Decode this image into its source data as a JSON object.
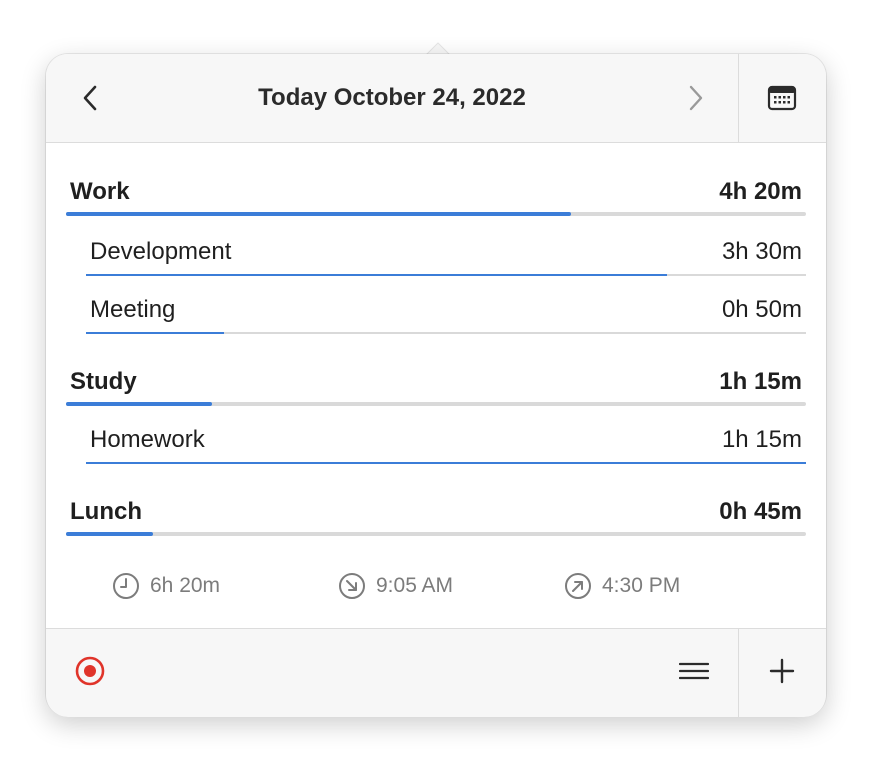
{
  "header": {
    "title": "Today October 24, 2022"
  },
  "entries": [
    {
      "label": "Work",
      "value": "4h 20m",
      "level": "top",
      "progress": 0.683
    },
    {
      "label": "Development",
      "value": "3h 30m",
      "level": "sub",
      "progress": 0.807
    },
    {
      "label": "Meeting",
      "value": "0h 50m",
      "level": "sub",
      "progress": 0.192
    },
    {
      "label": "Study",
      "value": "1h 15m",
      "level": "top",
      "progress": 0.197
    },
    {
      "label": "Homework",
      "value": "1h 15m",
      "level": "sub",
      "progress": 1.0
    },
    {
      "label": "Lunch",
      "value": "0h 45m",
      "level": "top",
      "progress": 0.118
    }
  ],
  "stats": {
    "total": "6h 20m",
    "start": "9:05 AM",
    "end": "4:30 PM"
  },
  "colors": {
    "accent": "#3b7dd8",
    "record": "#e0342a",
    "track": "#d9d9d9"
  },
  "icons": {
    "prev": "chevron-left-icon",
    "next": "chevron-right-icon",
    "calendar": "calendar-icon",
    "total": "clock-icon",
    "start": "arrow-down-right-circle-icon",
    "end": "arrow-up-right-circle-icon",
    "record": "record-icon",
    "menu": "menu-icon",
    "add": "plus-icon"
  }
}
